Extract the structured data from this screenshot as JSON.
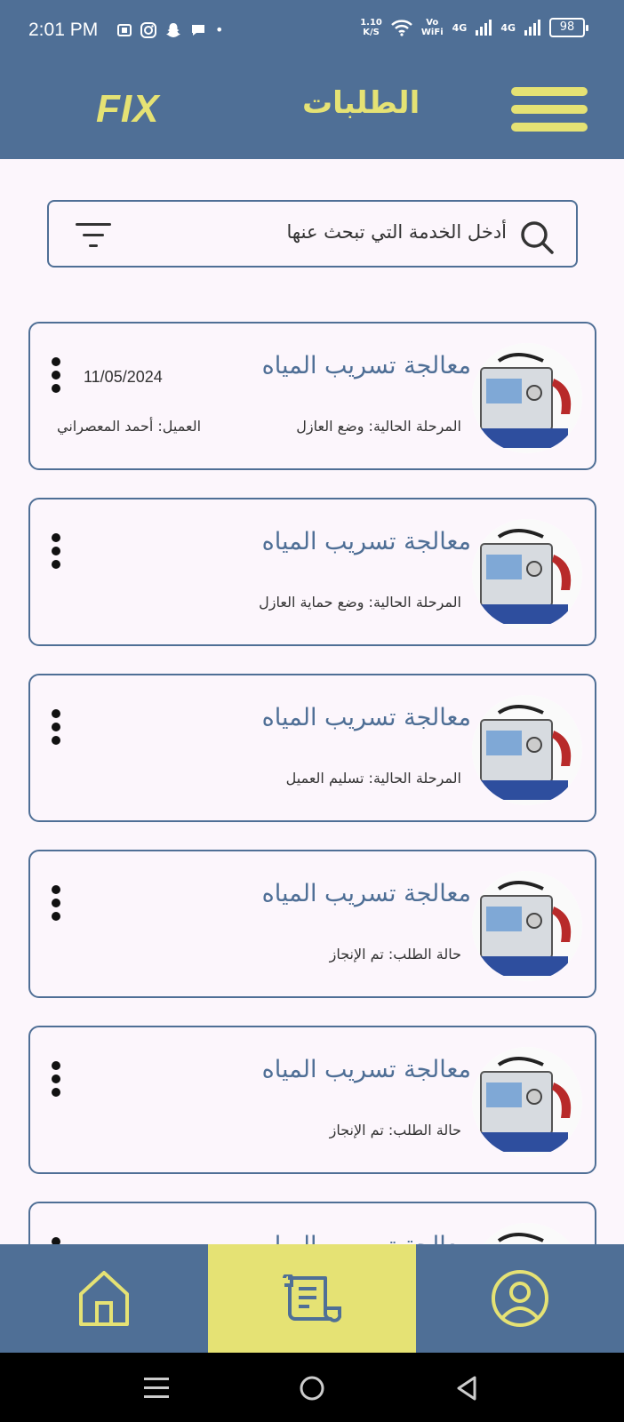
{
  "status_bar": {
    "time": "2:01 PM",
    "speed_value": "1.10",
    "speed_unit": "K/S",
    "vowifi_line1": "Vo",
    "vowifi_line2": "WiFi",
    "signal1_label": "4G",
    "signal2_label": "4G",
    "battery": "98",
    "notification_dot": "•"
  },
  "app_bar": {
    "logo": "FIX",
    "title": "الطلبات"
  },
  "search": {
    "placeholder": "أدخل الخدمة التي تبحث عنها"
  },
  "orders": [
    {
      "title": "معالجة تسريب المياه",
      "date": "11/05/2024",
      "stage": "المرحلة الحالية: وضع العازل",
      "client": "العميل: أحمد المعصراني"
    },
    {
      "title": "معالجة تسريب المياه",
      "stage": "المرحلة الحالية: وضع حماية العازل"
    },
    {
      "title": "معالجة تسريب المياه",
      "stage": "المرحلة الحالية: تسليم العميل"
    },
    {
      "title": "معالجة تسريب المياه",
      "stage": "حالة الطلب: تم الإنجاز"
    },
    {
      "title": "معالجة تسريب المياه",
      "stage": "حالة الطلب: تم الإنجاز"
    },
    {
      "title": "معالجة تسريب المياه"
    }
  ],
  "colors": {
    "primary": "#4f6f96",
    "accent": "#e5e274",
    "background": "#fcf6fc"
  },
  "bottom_nav": {
    "items": [
      "home-icon",
      "orders-scroll-icon",
      "profile-icon"
    ],
    "selected": "orders-scroll-icon"
  }
}
